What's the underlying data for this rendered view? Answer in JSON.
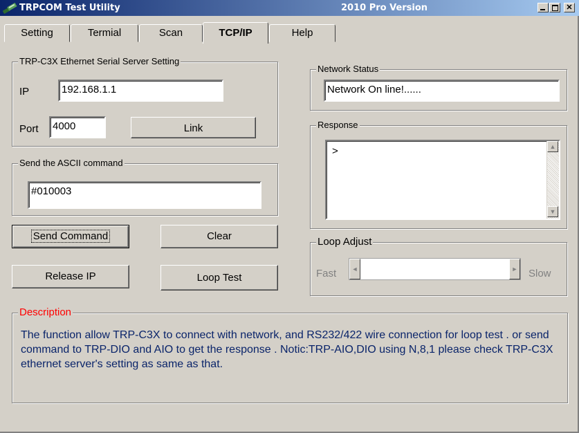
{
  "window": {
    "title": "TRPCOM Test Utility",
    "version": "2010 Pro Version",
    "minimize_icon": "minimize-icon",
    "restore_icon": "restore-icon",
    "close_icon": "close-icon"
  },
  "tabs": [
    {
      "label": "Setting",
      "active": false
    },
    {
      "label": "Termial",
      "active": false
    },
    {
      "label": "Scan",
      "active": false
    },
    {
      "label": "TCP/IP",
      "active": true
    },
    {
      "label": "Help",
      "active": false
    }
  ],
  "server_setting": {
    "group_label": "TRP-C3X Ethernet Serial Server Setting",
    "ip_label": "IP",
    "ip_value": "192.168.1.1",
    "port_label": "Port",
    "port_value": "4000",
    "link_button": "Link"
  },
  "ascii_command": {
    "group_label": "Send the ASCII command",
    "value": "#010003"
  },
  "buttons": {
    "send": "Send Command",
    "clear": "Clear",
    "release": "Release IP",
    "loop": "Loop Test"
  },
  "network_status": {
    "group_label": "Network Status",
    "value": "Network On line!......"
  },
  "response": {
    "group_label": "Response",
    "value": ">"
  },
  "loop_adjust": {
    "group_label": "Loop Adjust",
    "fast_label": "Fast",
    "slow_label": "Slow",
    "position": 0
  },
  "description": {
    "label": "Description",
    "text": "The function allow TRP-C3X to connect with network, and RS232/422 wire connection for loop test . or send command to TRP-DIO and AIO  to get the response . Notic:TRP-AIO,DIO using N,8,1 please check TRP-C3X ethernet server's  setting  as same as that."
  },
  "colors": {
    "title_gradient_start": "#0a246a",
    "title_gradient_end": "#a6caf0",
    "description_label": "#ff0000",
    "description_text": "#0a246a"
  }
}
